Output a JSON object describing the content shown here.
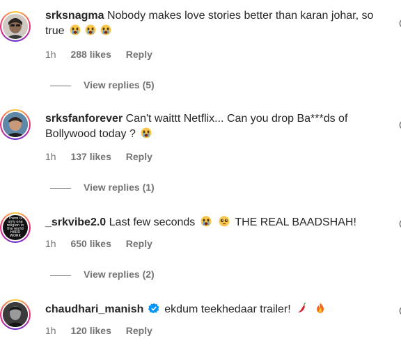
{
  "comments": [
    {
      "username": "srksnagma",
      "text": "Nobody makes love stories better than karan johar, so true",
      "emojis": [
        "crying-face",
        "crying-face",
        "crying-face"
      ],
      "time": "1h",
      "likes": "288 likes",
      "reply": "Reply",
      "view_replies": "View replies (5)",
      "verified": false
    },
    {
      "username": "srksfanforever",
      "text": "Can't waittt Netflix... Can you drop Ba***ds of Bollywood today ?",
      "emojis": [
        "crying-face"
      ],
      "time": "1h",
      "likes": "137 likes",
      "reply": "Reply",
      "view_replies": "View replies (1)",
      "verified": false
    },
    {
      "username": "_srkvibe2.0",
      "text": "Last few seconds",
      "text_after": "THE REAL BAADSHAH!",
      "emojis": [
        "crying-face",
        "pleading-face"
      ],
      "time": "1h",
      "likes": "650 likes",
      "reply": "Reply",
      "view_replies": "View replies (2)",
      "verified": false,
      "avatar_text": "There is only one religion in the world HARD WORK"
    },
    {
      "username": "chaudhari_manish",
      "text": "ekdum teekhedaar trailer!",
      "emojis": [
        "hot-pepper",
        "fire"
      ],
      "time": "1h",
      "likes": "120 likes",
      "reply": "Reply",
      "verified": true
    }
  ],
  "colors": {
    "text": "#262626",
    "secondary": "#737373",
    "verified": "#0095f6"
  }
}
